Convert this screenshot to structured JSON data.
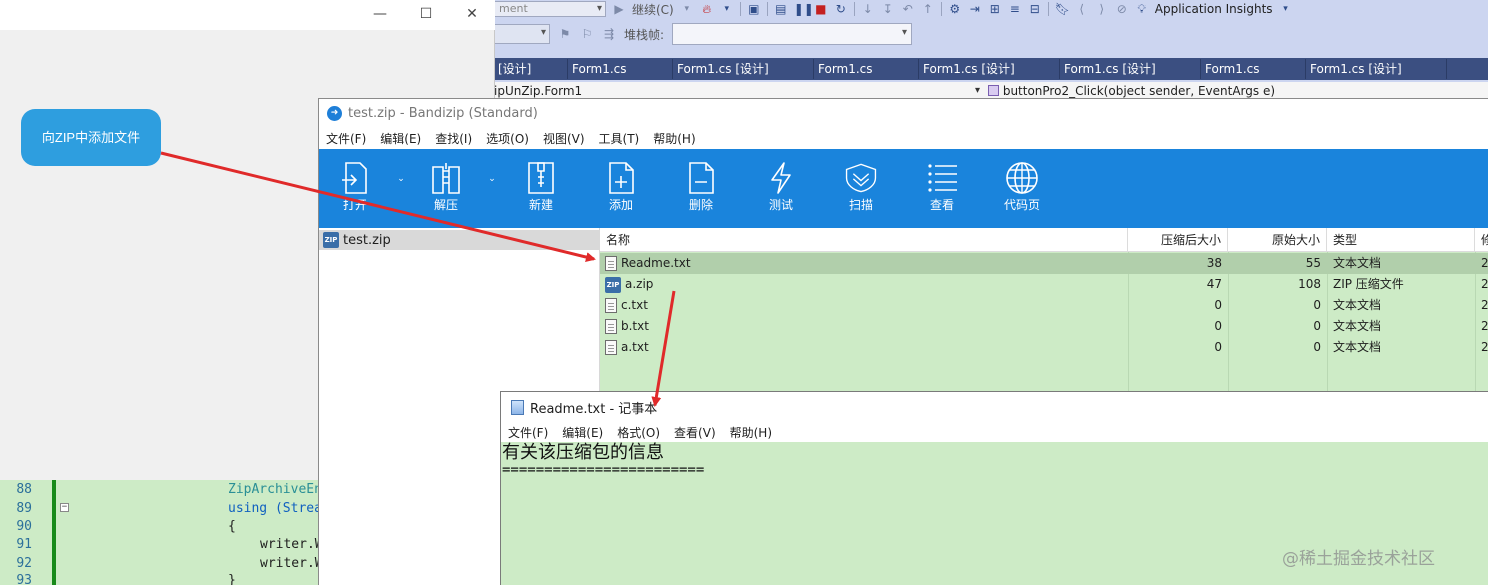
{
  "vs": {
    "toolbar": {
      "config_combo": "ment",
      "continue_label": "继续(C)",
      "app_insights_label": "Application Insights",
      "stack_frame_label": "堆栈帧:"
    },
    "tabs": [
      "[设计]",
      "Form1.cs",
      "Form1.cs [设计]",
      "Form1.cs",
      "Form1.cs [设计]",
      "Form1.cs [设计]",
      "Form1.cs",
      "Form1.cs [设计]"
    ],
    "nav": {
      "left": "ipUnZip.Form1",
      "right": "buttonPro2_Click(object sender, EventArgs e)"
    },
    "code_lines": [
      {
        "num": "88",
        "text": "ZipArchiveEn"
      },
      {
        "num": "89",
        "text": "using (Strea"
      },
      {
        "num": "90",
        "text": "{"
      },
      {
        "num": "91",
        "text": "writer.W"
      },
      {
        "num": "92",
        "text": "writer.W"
      },
      {
        "num": "93",
        "text": "}"
      }
    ]
  },
  "form": {
    "button_label": "向ZIP中添加文件",
    "controls": {
      "minimize": "—",
      "maximize": "☐",
      "close": "✕"
    }
  },
  "bandizip": {
    "title": "test.zip - Bandizip (Standard)",
    "menu": [
      "文件(F)",
      "编辑(E)",
      "查找(I)",
      "选项(O)",
      "视图(V)",
      "工具(T)",
      "帮助(H)"
    ],
    "ribbon": [
      {
        "label": "打开",
        "icon": "open-icon"
      },
      {
        "label": "解压",
        "icon": "extract-icon"
      },
      {
        "label": "新建",
        "icon": "new-archive-icon"
      },
      {
        "label": "添加",
        "icon": "add-file-icon"
      },
      {
        "label": "删除",
        "icon": "delete-file-icon"
      },
      {
        "label": "测试",
        "icon": "test-lightning-icon"
      },
      {
        "label": "扫描",
        "icon": "scan-shield-icon"
      },
      {
        "label": "查看",
        "icon": "view-list-icon"
      },
      {
        "label": "代码页",
        "icon": "codepage-globe-icon"
      }
    ],
    "tree_item": "test.zip",
    "columns": {
      "name": "名称",
      "compressed": "压缩后大小",
      "original": "原始大小",
      "type": "类型",
      "extra": "修"
    },
    "files": [
      {
        "name": "Readme.txt",
        "compressed": "38",
        "original": "55",
        "type": "文本文档",
        "extra": "2",
        "icon": "text-file-icon",
        "selected": true
      },
      {
        "name": "a.zip",
        "compressed": "47",
        "original": "108",
        "type": "ZIP 压缩文件",
        "extra": "2",
        "icon": "zip-file-icon",
        "selected": false
      },
      {
        "name": "c.txt",
        "compressed": "0",
        "original": "0",
        "type": "文本文档",
        "extra": "2",
        "icon": "text-file-icon",
        "selected": false
      },
      {
        "name": "b.txt",
        "compressed": "0",
        "original": "0",
        "type": "文本文档",
        "extra": "2",
        "icon": "text-file-icon",
        "selected": false
      },
      {
        "name": "a.txt",
        "compressed": "0",
        "original": "0",
        "type": "文本文档",
        "extra": "2",
        "icon": "text-file-icon",
        "selected": false
      }
    ]
  },
  "notepad": {
    "title": "Readme.txt - 记事本",
    "menu": [
      "文件(F)",
      "编辑(E)",
      "格式(O)",
      "查看(V)",
      "帮助(H)"
    ],
    "content_line1": "有关该压缩包的信息",
    "content_line2": "========================"
  },
  "watermark": "@稀土掘金技术社区",
  "colors": {
    "accent_blue": "#1a84dc",
    "eye_care_green": "#cdebc6",
    "arrow_red": "#e02a2a",
    "form_button": "#2e9edf"
  }
}
